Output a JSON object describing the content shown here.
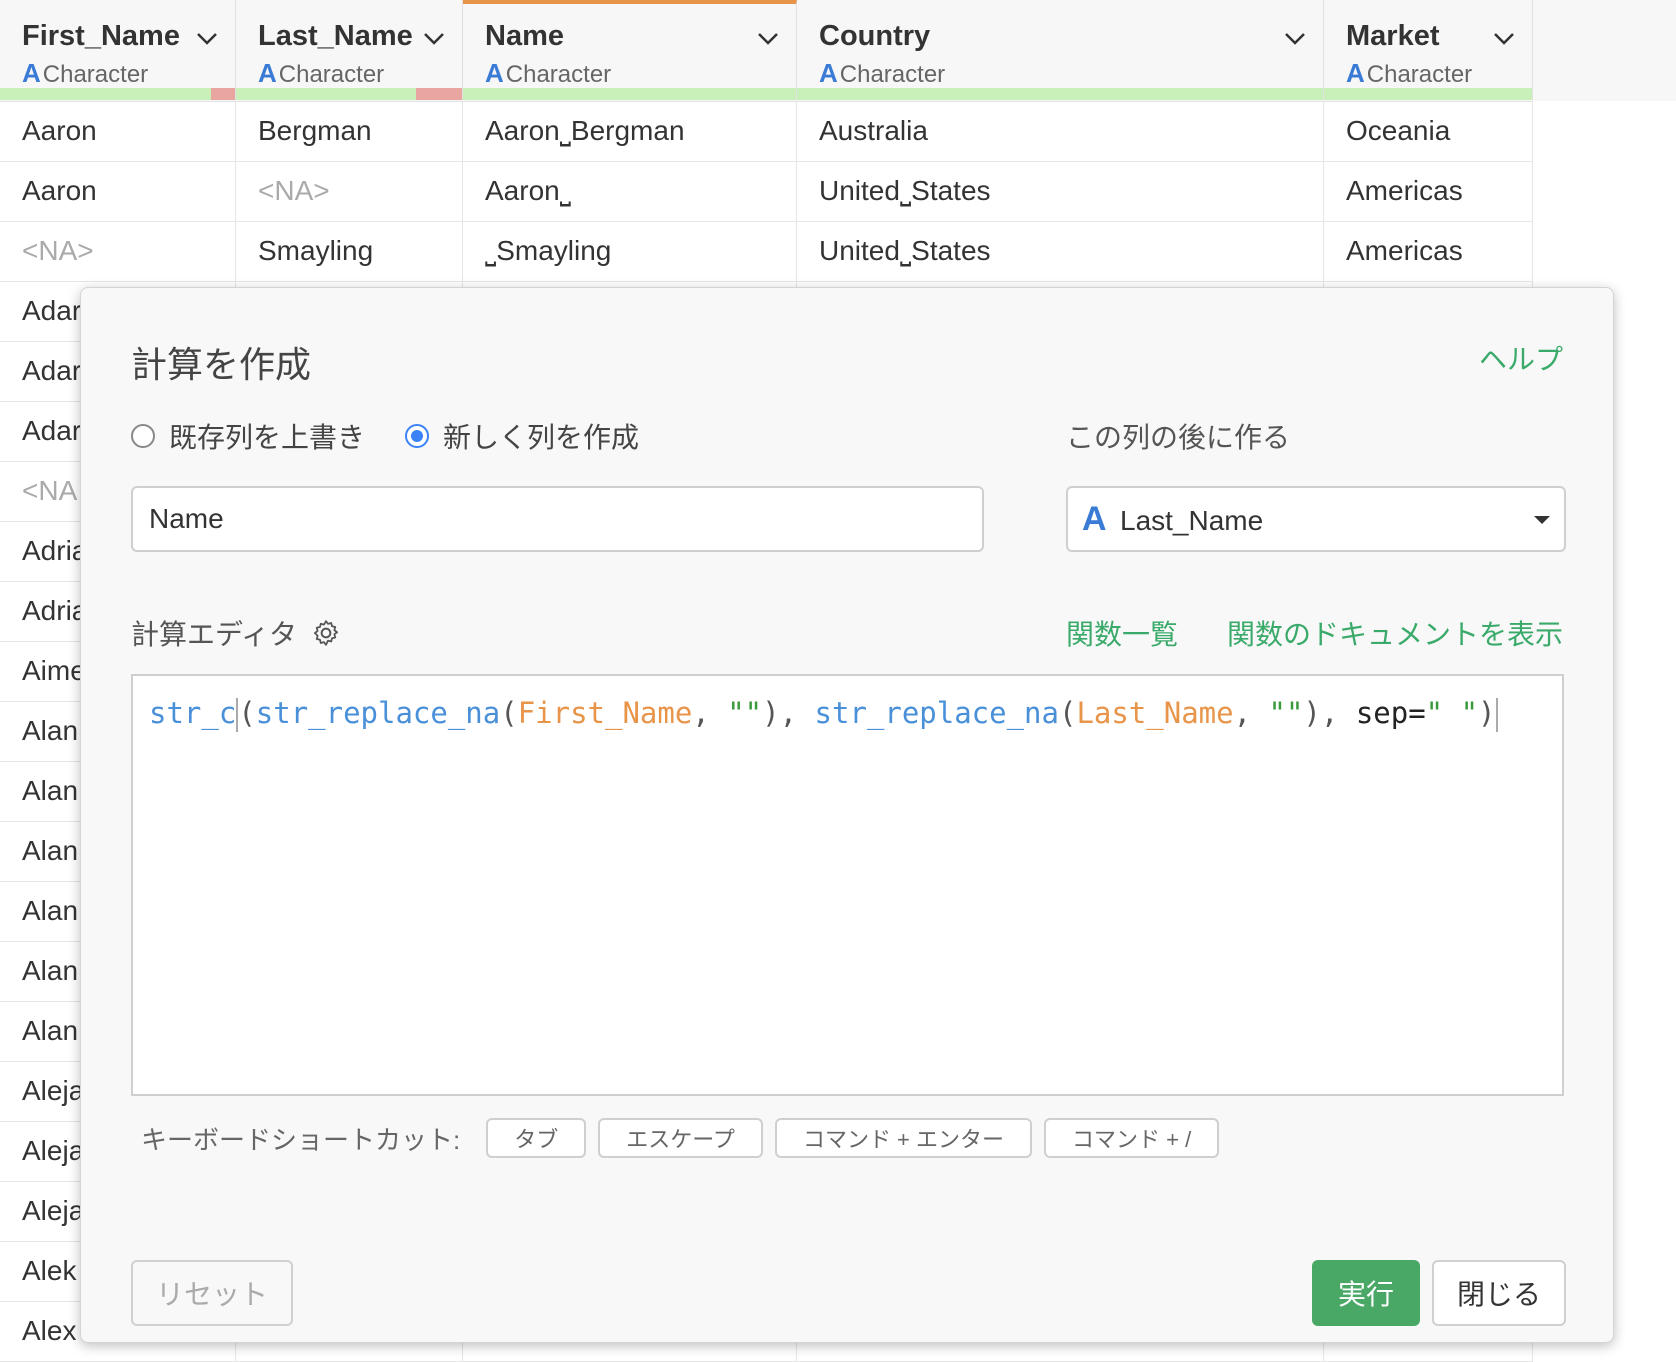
{
  "columns": [
    {
      "name": "First_Name",
      "type_letter": "A",
      "type": "Character"
    },
    {
      "name": "Last_Name",
      "type_letter": "A",
      "type": "Character"
    },
    {
      "name": "Name",
      "type_letter": "A",
      "type": "Character"
    },
    {
      "name": "Country",
      "type_letter": "A",
      "type": "Character"
    },
    {
      "name": "Market",
      "type_letter": "A",
      "type": "Character"
    }
  ],
  "rows": [
    [
      "Aaron",
      "Bergman",
      "Aaron⎵Bergman",
      "Australia",
      "Oceania"
    ],
    [
      "Aaron",
      "<NA>",
      "Aaron⎵",
      "United⎵States",
      "Americas"
    ],
    [
      "<NA>",
      "Smayling",
      "⎵Smayling",
      "United⎵States",
      "Americas"
    ]
  ],
  "partial_rows": [
    "Adar",
    "Adar",
    "Adar",
    "<NA",
    "Adria",
    "Adria",
    "Aime",
    "Alan",
    "Alan",
    "Alan",
    "Alan",
    "Alan",
    "Alan",
    "Aleja",
    "Aleja",
    "Aleja",
    "Alek",
    "Alex"
  ],
  "dialog": {
    "title": "計算を作成",
    "help": "ヘルプ",
    "radio_overwrite": "既存列を上書き",
    "radio_new": "新しく列を作成",
    "after_label": "この列の後に作る",
    "name_value": "Name",
    "after_column_letter": "A",
    "after_column": "Last_Name",
    "editor_label": "計算エディタ",
    "functions_link": "関数一覧",
    "docs_link": "関数のドキュメントを表示",
    "code": {
      "fn1": "str_c",
      "fn2": "str_replace_na",
      "col1": "First_Name",
      "col2": "Last_Name",
      "empty_str": "\"\"",
      "sep_label": "sep=",
      "sep_str": "\" \""
    },
    "shortcuts_label": "キーボードショートカット:",
    "shortcuts": [
      "タブ",
      "エスケープ",
      "コマンド + エンター",
      "コマンド + /"
    ],
    "reset": "リセット",
    "run": "実行",
    "close": "閉じる"
  },
  "colors": {
    "accent_green": "#3aaa6a",
    "run_button": "#4aa866",
    "type_blue": "#3a7bd5",
    "active_column": "#e8954a"
  }
}
